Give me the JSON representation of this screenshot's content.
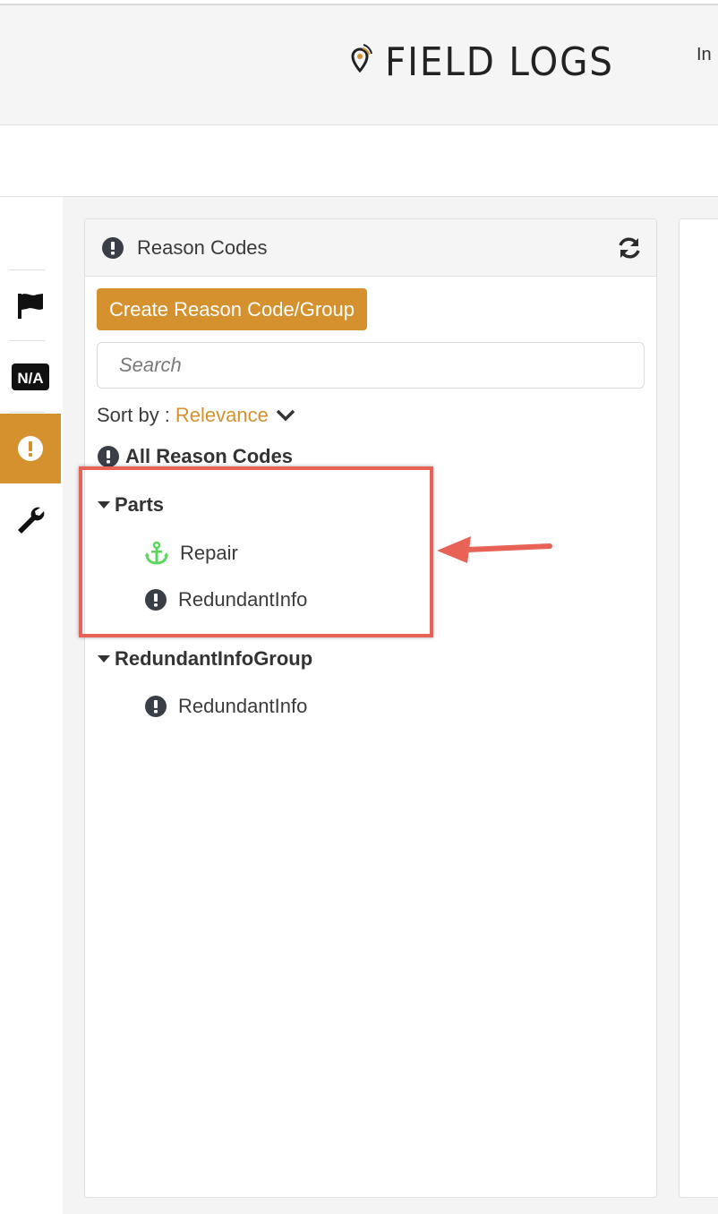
{
  "header": {
    "brand": "FIELD LOGS",
    "cut_text": "In"
  },
  "sidenav": {
    "items": [
      {
        "name": "flag-icon",
        "active": false
      },
      {
        "name": "na-icon",
        "label": "N/A",
        "active": false
      },
      {
        "name": "alert-icon",
        "active": true
      },
      {
        "name": "wrench-icon",
        "active": false
      }
    ]
  },
  "panel": {
    "title": "Reason Codes",
    "create_button": "Create Reason Code/Group",
    "search_placeholder": "Search",
    "sort_label": "Sort by :",
    "sort_value": "Relevance",
    "all_label": "All Reason Codes",
    "groups": [
      {
        "name": "Parts",
        "items": [
          {
            "label": "Repair",
            "icon": "anchor-icon"
          },
          {
            "label": "RedundantInfo",
            "icon": "alert-icon"
          }
        ]
      },
      {
        "name": "RedundantInfoGroup",
        "items": [
          {
            "label": "RedundantInfo",
            "icon": "alert-icon"
          }
        ]
      }
    ]
  },
  "colors": {
    "accent": "#d4912e",
    "anchor": "#5cd65c",
    "highlight": "#e86255"
  }
}
